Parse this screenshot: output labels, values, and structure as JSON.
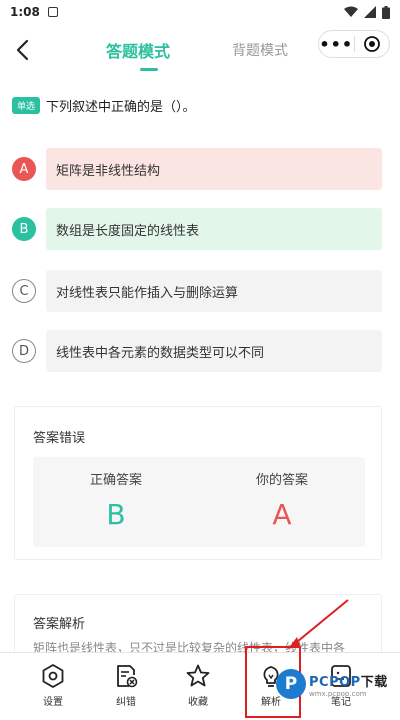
{
  "status_bar": {
    "time": "1:08"
  },
  "nav": {
    "tab_answer": "答题模式",
    "tab_recite": "背题模式",
    "more_glyph": "•••"
  },
  "question": {
    "type_tag": "单选",
    "text": "下列叙述中正确的是（）。",
    "options": [
      {
        "letter": "A",
        "text": "矩阵是非线性结构",
        "state": "wrong"
      },
      {
        "letter": "B",
        "text": "数组是长度固定的线性表",
        "state": "correct"
      },
      {
        "letter": "C",
        "text": "对线性表只能作插入与删除运算",
        "state": "neutral"
      },
      {
        "letter": "D",
        "text": "线性表中各元素的数据类型可以不同",
        "state": "neutral"
      }
    ]
  },
  "result": {
    "title": "答案错误",
    "correct_label": "正确答案",
    "correct_value": "B",
    "your_label": "你的答案",
    "your_value": "A"
  },
  "analysis": {
    "title": "答案解析",
    "text": "矩阵也是线性表，只不过是比较复杂的线性表，线性表中各"
  },
  "bottom_bar": {
    "settings_label": "设置",
    "correction_label": "纠错",
    "favorite_label": "收藏",
    "analysis_label": "解析",
    "note_label": "笔记"
  },
  "watermark": {
    "logo_letter": "P",
    "brand": "PCPOP",
    "suffix": "下载",
    "sub": "wmx.pcpop.com"
  },
  "colors": {
    "accent": "#2bc0a0",
    "wrong": "#e85656",
    "highlight": "#e02020"
  }
}
